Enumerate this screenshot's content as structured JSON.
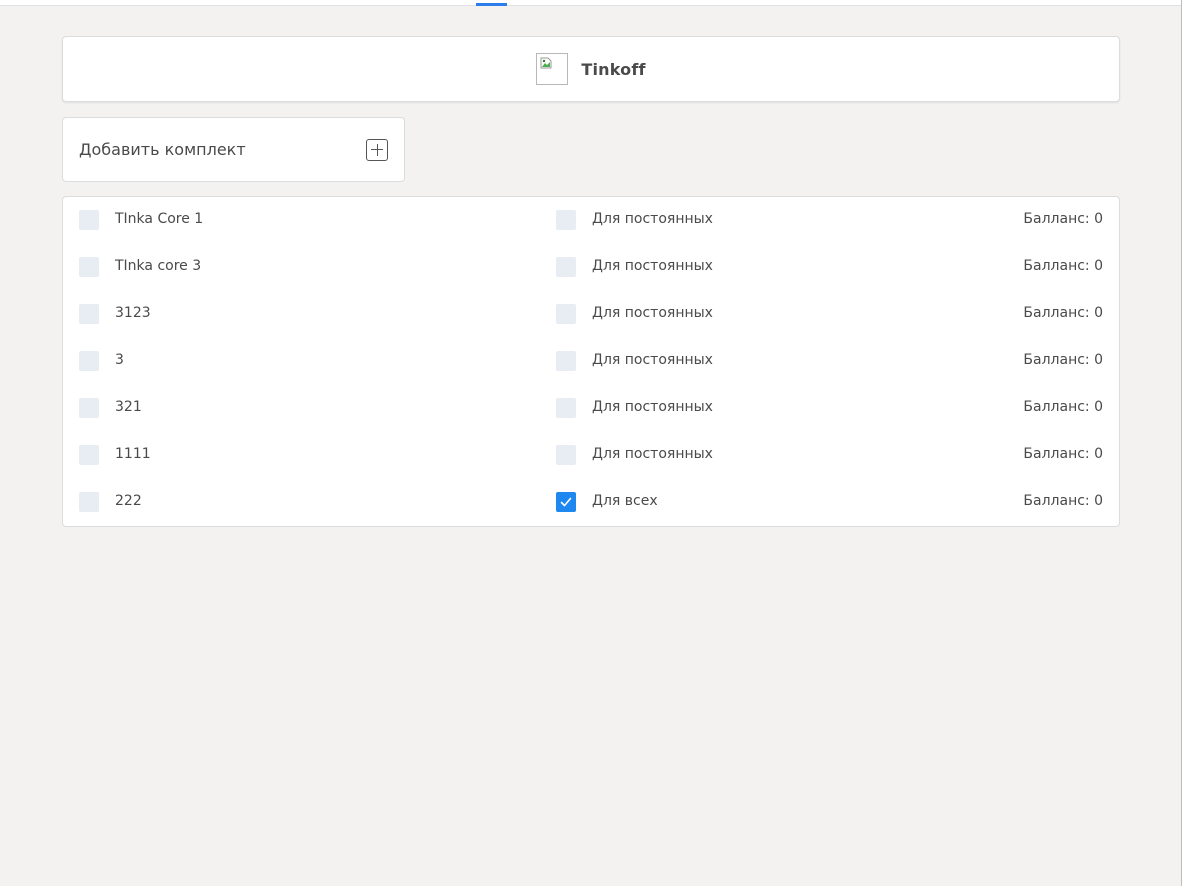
{
  "header": {
    "bank_name": "Tinkoff",
    "logo_icon": "broken-image-icon"
  },
  "add_kit": {
    "label": "Добавить комплект",
    "icon": "plus-square-icon"
  },
  "kits": [
    {
      "name": "TInka Core 1",
      "group": "Для постоянных",
      "balance": "Балланс: 0",
      "selected": false,
      "group_checked": false
    },
    {
      "name": "TInka core 3",
      "group": "Для постоянных",
      "balance": "Балланс: 0",
      "selected": false,
      "group_checked": false
    },
    {
      "name": "3123",
      "group": "Для постоянных",
      "balance": "Балланс: 0",
      "selected": false,
      "group_checked": false
    },
    {
      "name": "3",
      "group": "Для постоянных",
      "balance": "Балланс: 0",
      "selected": false,
      "group_checked": false
    },
    {
      "name": "321",
      "group": "Для постоянных",
      "balance": "Балланс: 0",
      "selected": false,
      "group_checked": false
    },
    {
      "name": "1111",
      "group": "Для постоянных",
      "balance": "Балланс: 0",
      "selected": false,
      "group_checked": false
    },
    {
      "name": "222",
      "group": "Для всех",
      "balance": "Балланс: 0",
      "selected": false,
      "group_checked": true
    }
  ],
  "colors": {
    "accent": "#1e88f0",
    "checkbox_unchecked": "#e8ecf3",
    "background": "#f3f2f1"
  }
}
